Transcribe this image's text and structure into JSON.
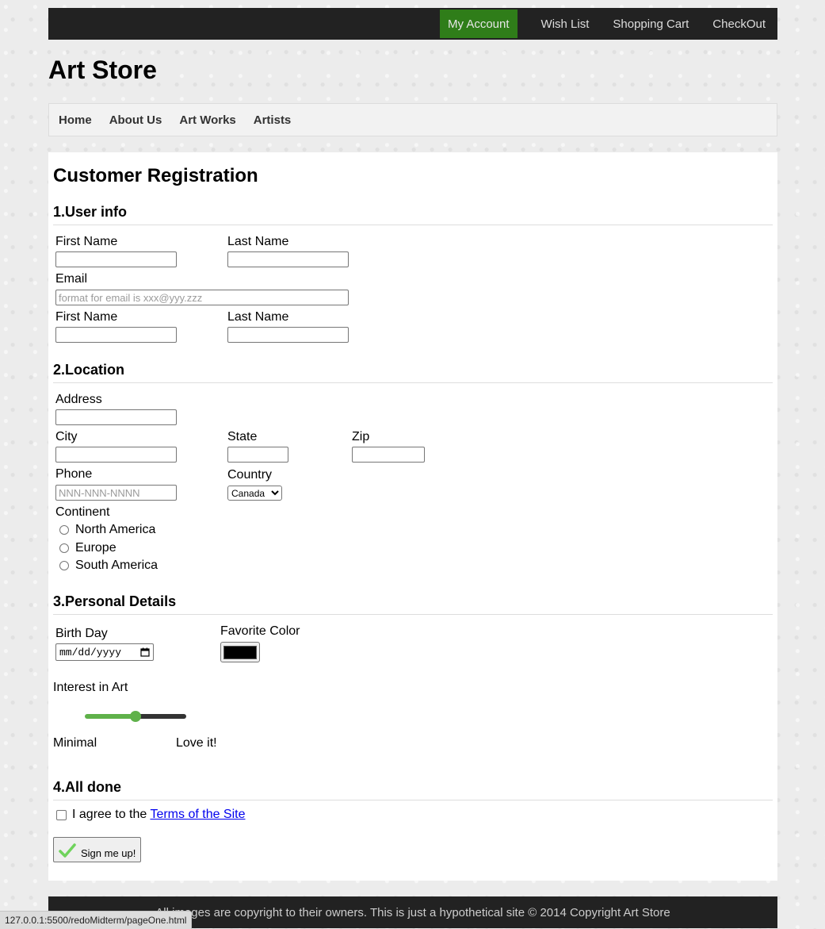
{
  "topnav": {
    "my_account": "My Account",
    "wish_list": "Wish List",
    "shopping_cart": "Shopping Cart",
    "checkout": "CheckOut"
  },
  "brand": "Art Store",
  "mainnav": {
    "home": "Home",
    "about": "About Us",
    "art_works": "Art Works",
    "artists": "Artists"
  },
  "page_title": "Customer Registration",
  "section1": {
    "title": "1.User info",
    "first_name": "First Name",
    "last_name": "Last Name",
    "email": "Email",
    "email_placeholder": "format for email is xxx@yyy.zzz",
    "first_name_2": "First Name",
    "last_name_2": "Last Name"
  },
  "section2": {
    "title": "2.Location",
    "address": "Address",
    "city": "City",
    "state": "State",
    "zip": "Zip",
    "phone": "Phone",
    "phone_placeholder": "NNN-NNN-NNNN",
    "country": "Country",
    "country_selected": "Canada",
    "continent": "Continent",
    "continents": [
      "North America",
      "Europe",
      "South America"
    ]
  },
  "section3": {
    "title": "3.Personal Details",
    "birth_day": "Birth Day",
    "date_placeholder": "mm/dd/yyyy",
    "favorite_color": "Favorite Color",
    "color_value": "#000000",
    "interest": "Interest in Art",
    "slider_value": 0.5,
    "min_label": "Minimal",
    "max_label": "Love it!"
  },
  "section4": {
    "title": "4.All done",
    "agree_text": "I agree to the",
    "terms_link": "Terms of the Site",
    "submit": "Sign me up!"
  },
  "footer": "All images are copyright to their owners. This is just a hypothetical site © 2014 Copyright Art Store",
  "status_url": "127.0.0.1:5500/redoMidterm/pageOne.html",
  "colors": {
    "accent_green": "#2f7d19",
    "slider_green": "#5fb14a",
    "dark_bar": "#222222"
  }
}
